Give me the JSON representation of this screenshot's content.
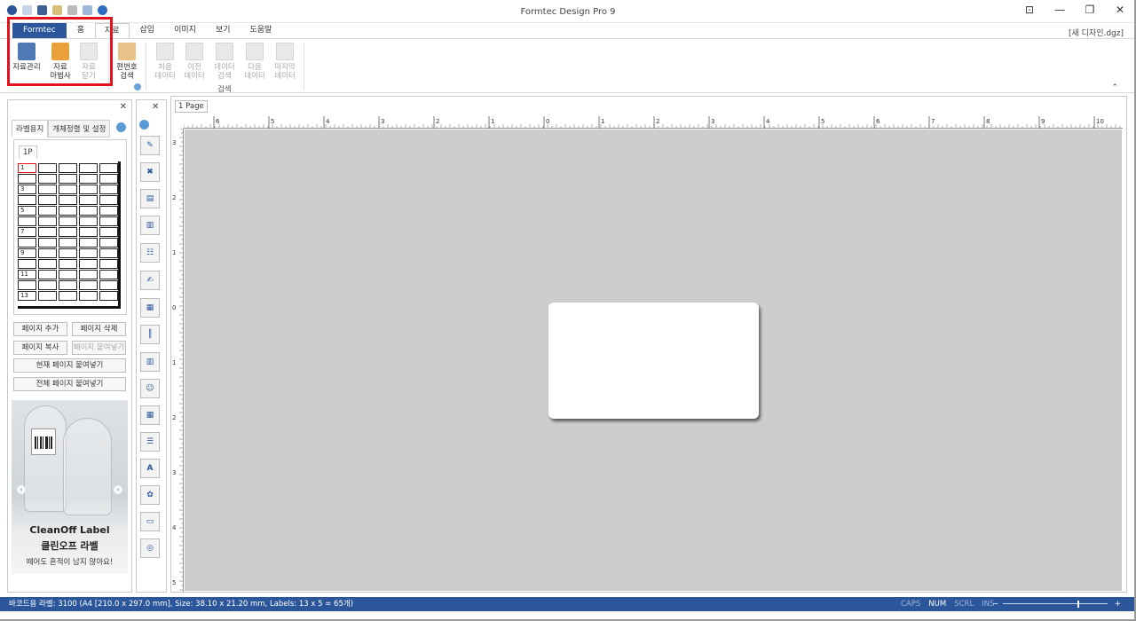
{
  "window": {
    "title": "Formtec Design Pro 9",
    "document_name": "[새 디자인.dgz]"
  },
  "ribbon_tabs": [
    {
      "label": "Formtec"
    },
    {
      "label": "홈"
    },
    {
      "label": "자료"
    },
    {
      "label": "삽입"
    },
    {
      "label": "이미지"
    },
    {
      "label": "보기"
    },
    {
      "label": "도움말"
    }
  ],
  "ribbon": {
    "data_manage": "자료관리",
    "data_wizard": "자료\n마법사",
    "data_close": "자료\n닫기",
    "serial_search": "편번호\n검색",
    "first_data": "처음\n데이터",
    "prev_data": "이전\n데이터",
    "data_search": "데이터\n검색",
    "next_data": "다음\n데이터",
    "last_data": "마지막\n데이터",
    "group_search": "검색"
  },
  "left_panel": {
    "tab_label_paper": "라벨용지",
    "tab_object_align": "개체정렬 및 설정",
    "page_tag": "1P",
    "cell_numbers": [
      "1",
      "3",
      "5",
      "7",
      "9",
      "11",
      "13"
    ],
    "add_page": "페이지 추가",
    "delete_page": "페이지 삭제",
    "copy_page": "페이지 복사",
    "paste_page": "페이지 붙여넣기",
    "paste_current": "현재 페이지 붙여넣기",
    "paste_all": "전체 페이지 붙여넣기",
    "ad": {
      "title": "CleanOff Label",
      "subtitle": "클린오프 라벨",
      "description": "떼어도 흔적이 남지 않아요!"
    }
  },
  "canvas": {
    "page_tab": "1 Page",
    "h_ruler_numbers": [
      "6",
      "5",
      "4",
      "3",
      "2",
      "1",
      "0",
      "1",
      "2",
      "3",
      "4",
      "5",
      "6",
      "7",
      "8",
      "9",
      "10"
    ],
    "v_ruler_numbers": [
      "3",
      "2",
      "1",
      "0",
      "1",
      "2",
      "3",
      "4",
      "5"
    ]
  },
  "status": {
    "text": "바코드용 라벨: 3100 (A4 [210.0 x 297.0 mm], Size: 38.10 x 21.20 mm,  Labels: 13 x 5 = 65개)",
    "caps": "CAPS",
    "num": "NUM",
    "scrl": "SCRL",
    "ins": "INS",
    "zoom_minus": "−",
    "zoom_plus": "+"
  },
  "colors": {
    "accent": "#2b579a",
    "highlight_box": "#e3121c",
    "canvas_bg": "#cdcdcd"
  }
}
